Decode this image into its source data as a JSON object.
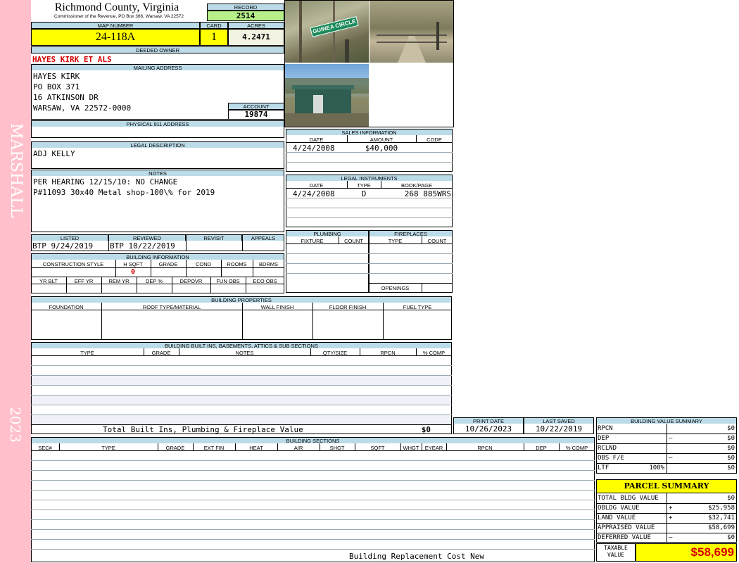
{
  "sidebar": {
    "district": "MARSHALL",
    "year": "2023",
    "color": "#ffc0cb"
  },
  "header": {
    "county": "Richmond County, Virginia",
    "commissioner": "Commissioner of the Revenue, PO Box 366, Warsaw, VA 22572",
    "record_label": "RECORD",
    "record": "2514",
    "map_label": "MAP NUMBER",
    "map": "24-118A",
    "card_label": "CARD",
    "card": "1",
    "acres_label": "ACRES",
    "acres": "4.2471"
  },
  "owner": {
    "deeded_label": "DEEDED OWNER",
    "deeded": "HAYES KIRK ET ALS",
    "mailing_label": "MAILING ADDRESS",
    "mailing": [
      "HAYES KIRK",
      "PO BOX 371",
      "16 ATKINSON DR",
      "WARSAW, VA 22572-0000"
    ],
    "account_label": "ACCOUNT",
    "account": "19874",
    "physical_label": "PHYSICAL 911 ADDRESS"
  },
  "photos": [
    {
      "caption": "GUINEA CIRCLE"
    },
    {
      "caption": ""
    },
    {
      "caption": ""
    }
  ],
  "legal": {
    "label": "LEGAL DESCRIPTION",
    "text": "ADJ KELLY"
  },
  "notes": {
    "label": "NOTES",
    "lines": [
      "PER HEARING 12/15/10: NO CHANGE",
      "P#11093 30x40 Metal shop-100\\% for 2019"
    ]
  },
  "listed": {
    "listed_label": "LISTED",
    "listed": "BTP  9/24/2019",
    "reviewed_label": "REVIEWED",
    "reviewed": "BTP 10/22/2019",
    "revisit_label": "REVISIT",
    "appeals_label": "APPEALS"
  },
  "building_info": {
    "label": "BUILDING INFORMATION",
    "cols": [
      "CONSTRUCTION STYLE",
      "H SQFT",
      "GRADE",
      "COND",
      "ROOMS",
      "BDRMS"
    ],
    "hsqft": "0",
    "cols2": [
      "YR BLT",
      "EFF YR",
      "REM YR",
      "DEP %",
      "DEPOVR",
      "FUN OBS",
      "ECO OBS"
    ]
  },
  "sales": {
    "label": "SALES INFORMATION",
    "cols": [
      "DATE",
      "AMOUNT",
      "CODE"
    ],
    "row": {
      "date": "4/24/2008",
      "amount": "$40,000",
      "code": ""
    }
  },
  "instruments": {
    "label": "LEGAL INSTRUMENTS",
    "cols": [
      "DATE",
      "TYPE",
      "BOOK/PAGE"
    ],
    "row": {
      "date": "4/24/2008",
      "type": "D",
      "book": "268 885WRS"
    }
  },
  "plumbing": {
    "label": "PLUMBING",
    "cols": [
      "FIXTURE",
      "COUNT"
    ]
  },
  "fireplaces": {
    "label": "FIREPLACES",
    "cols": [
      "TYPE",
      "COUNT"
    ],
    "openings": "OPENINGS"
  },
  "properties": {
    "label": "BUILDING PROPERTIES",
    "cols": [
      "FOUNDATION",
      "ROOF TYPE/MATERIAL",
      "WALL FINISH",
      "FLOOR FINISH",
      "FUEL TYPE"
    ]
  },
  "builtins": {
    "label": "BUILDING BUILT INS, BASEMENTS, ATTICS & SUB SECTIONS",
    "cols": [
      "TYPE",
      "GRADE",
      "NOTES",
      "QTY/SIZE",
      "RPCN",
      "% COMP"
    ],
    "total_label": "Total Built Ins, Plumbing & Fireplace Value",
    "total": "$0"
  },
  "print": {
    "print_label": "PRINT DATE",
    "print": "10/26/2023",
    "saved_label": "LAST SAVED",
    "saved": "10/22/2019"
  },
  "sections": {
    "label": "BUILDING SECTIONS",
    "cols": [
      "SEC#",
      "TYPE",
      "GRADE",
      "EXT FIN",
      "HEAT",
      "AIR",
      "SHGT",
      "SQFT",
      "WHGT",
      "EYEAR",
      "RPCN",
      "DEP",
      "% COMP"
    ],
    "footer": "Building Replacement Cost New"
  },
  "bvs": {
    "label": "BUILDING VALUE SUMMARY",
    "rows": [
      {
        "label": "RPCN",
        "sign": "",
        "value": "$0"
      },
      {
        "label": "DEP",
        "sign": "–",
        "value": "$0"
      },
      {
        "label": "RCLND",
        "sign": "",
        "value": "$0"
      },
      {
        "label": "OBS F/E",
        "sign": "–",
        "value": "$0"
      },
      {
        "label": "LTF",
        "sign": "100%",
        "value": "$0"
      }
    ]
  },
  "parcel": {
    "label": "PARCEL SUMMARY",
    "rows": [
      {
        "label": "TOTAL BLDG VALUE",
        "sign": "",
        "value": "$0"
      },
      {
        "label": "OBLDG VALUE",
        "sign": "+",
        "value": "$25,958"
      },
      {
        "label": "LAND VALUE",
        "sign": "+",
        "value": "$32,741"
      },
      {
        "label": "APPRAISED VALUE",
        "sign": "",
        "value": "$58,699"
      },
      {
        "label": "DEFERRED VALUE",
        "sign": "–",
        "value": "$0"
      }
    ],
    "taxable_label": "TAXABLE VALUE",
    "taxable": "$58,699"
  }
}
